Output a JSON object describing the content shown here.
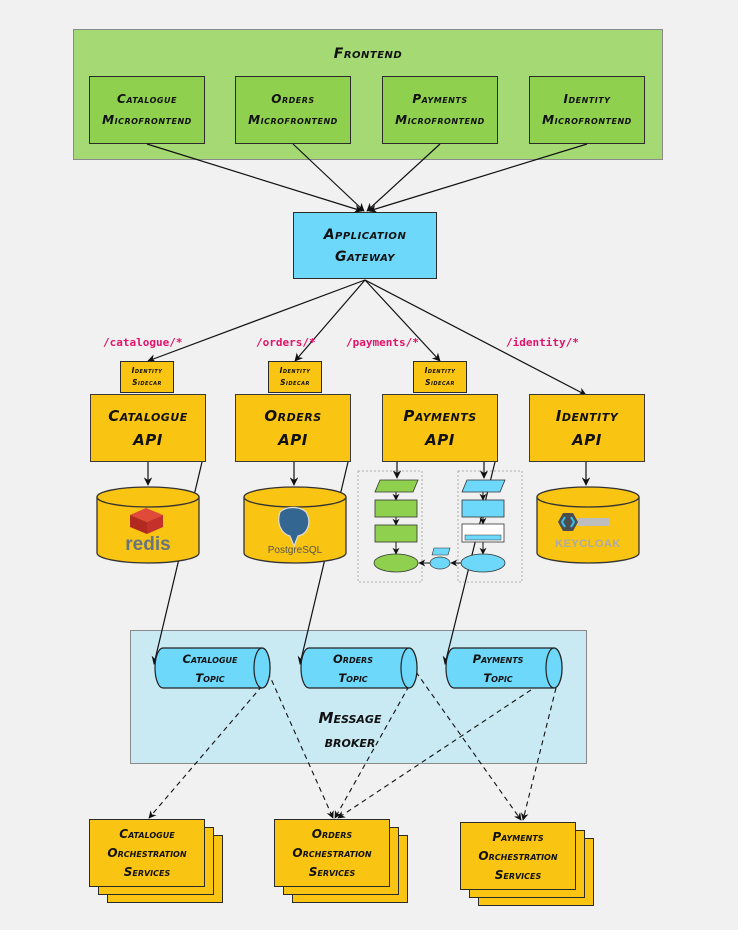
{
  "frontend": {
    "title": "Frontend",
    "microfrontends": [
      {
        "line1": "Catalogue",
        "line2": "Microfrontend"
      },
      {
        "line1": "Orders",
        "line2": "Microfrontend"
      },
      {
        "line1": "Payments",
        "line2": "Microfrontend"
      },
      {
        "line1": "Identity",
        "line2": "Microfrontend"
      }
    ]
  },
  "gateway": {
    "line1": "Application",
    "line2": "Gateway"
  },
  "routes": [
    "/catalogue/*",
    "/orders/*",
    "/payments/*",
    "/identity/*"
  ],
  "sidecar": {
    "line1": "Identity",
    "line2": "Sidecar"
  },
  "apis": [
    {
      "line1": "Catalogue",
      "line2": "API"
    },
    {
      "line1": "Orders",
      "line2": "API"
    },
    {
      "line1": "Payments",
      "line2": "API"
    },
    {
      "line1": "Identity",
      "line2": "API"
    }
  ],
  "datastores": [
    {
      "name": "redis",
      "icon": "redis-logo-icon"
    },
    {
      "name": "PostgreSQL",
      "icon": "postgresql-elephant-icon"
    },
    {
      "name": "KEYCLOAK",
      "icon": "keycloak-key-icon"
    }
  ],
  "broker": {
    "line1": "Message",
    "line2": "broker",
    "topics": [
      {
        "line1": "Catalogue",
        "line2": "Topic"
      },
      {
        "line1": "Orders",
        "line2": "Topic"
      },
      {
        "line1": "Payments",
        "line2": "Topic"
      }
    ]
  },
  "orchestration": [
    {
      "line1": "Catalogue",
      "line2": "Orchestration",
      "line3": "Services"
    },
    {
      "line1": "Orders",
      "line2": "Orchestration",
      "line3": "Services"
    },
    {
      "line1": "Payments",
      "line2": "Orchestration",
      "line3": "Services"
    }
  ],
  "colors": {
    "frontend_container": "#a5d974",
    "microfrontend": "#8fd04e",
    "gateway": "#6dd8fa",
    "api": "#f9c412",
    "broker": "#c9e9f3",
    "route_label": "#e3126b"
  }
}
